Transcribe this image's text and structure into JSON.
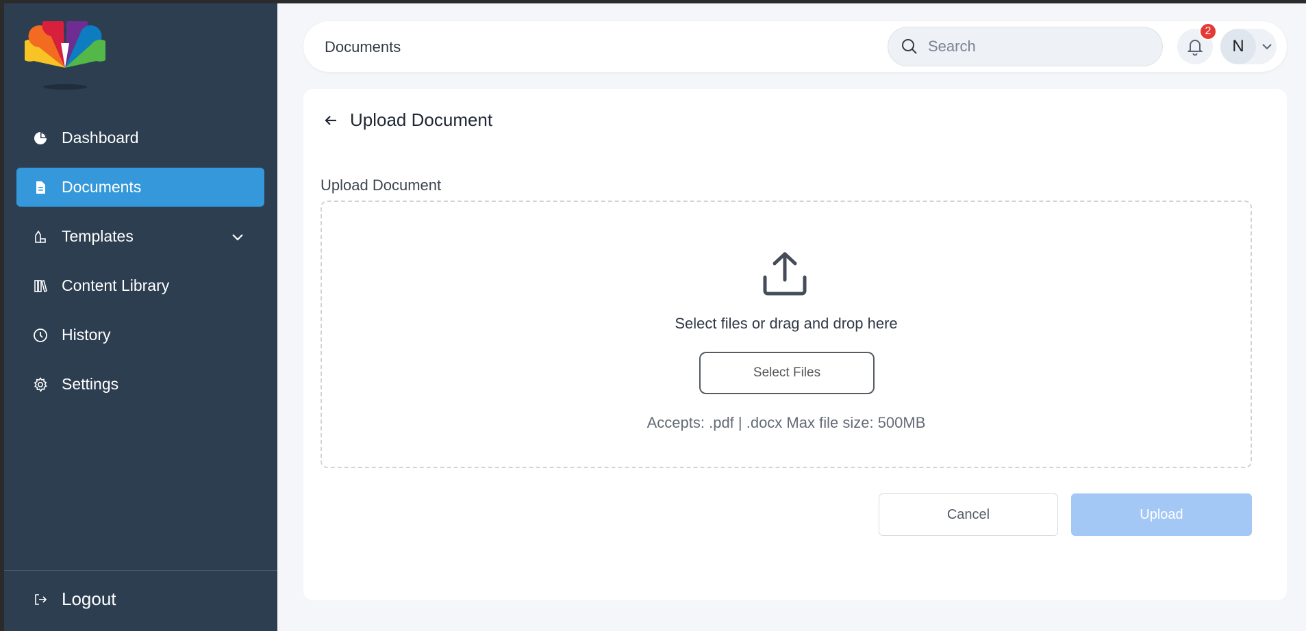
{
  "sidebar": {
    "logo_icon": "peacock-logo",
    "items": [
      {
        "label": "Dashboard",
        "icon": "pie-chart-icon",
        "active": false
      },
      {
        "label": "Documents",
        "icon": "document-icon",
        "active": true
      },
      {
        "label": "Templates",
        "icon": "template-icon",
        "active": false,
        "has_submenu": true
      },
      {
        "label": "Content Library",
        "icon": "library-icon",
        "active": false
      },
      {
        "label": "History",
        "icon": "clock-icon",
        "active": false
      },
      {
        "label": "Settings",
        "icon": "gear-icon",
        "active": false
      }
    ],
    "logout_label": "Logout",
    "colors": {
      "background": "#2c3e50",
      "active": "#3498db"
    }
  },
  "header": {
    "title": "Documents",
    "search_placeholder": "Search",
    "notification_count": "2",
    "user_initial": "N"
  },
  "page": {
    "title": "Upload Document",
    "section_label": "Upload Document",
    "dropzone": {
      "prompt": "Select files or drag and drop here",
      "select_button": "Select Files",
      "accepts": "Accepts: .pdf | .docx Max file size: 500MB"
    },
    "actions": {
      "cancel": "Cancel",
      "upload": "Upload"
    }
  }
}
